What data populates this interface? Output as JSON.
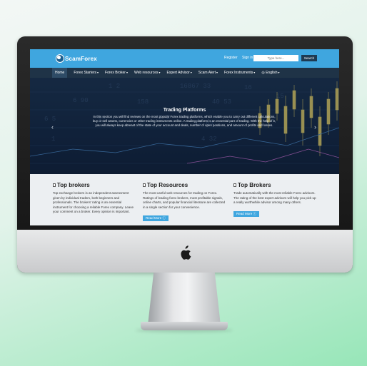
{
  "site": {
    "logo_text": "ScamForex",
    "header_links": [
      "Register",
      "Sign in"
    ],
    "search_placeholder": "Type here...",
    "search_button": "Search"
  },
  "nav": [
    {
      "label": "Home"
    },
    {
      "label": "Forex Starters"
    },
    {
      "label": "Forex Broker"
    },
    {
      "label": "Web resources"
    },
    {
      "label": "Expert Advisor"
    },
    {
      "label": "Scam Alert"
    },
    {
      "label": "Forex Instruments"
    },
    {
      "label": "English"
    }
  ],
  "hero": {
    "title": "Trading Platforms",
    "text": "In this section you will find reviews on the most popular Forex trading platforms, which enable you to carry out different calculations, buy or sell assets, currencies or other trading instruments online. A trading platform is an essential part of trading. With the help of it, you will always keep abreast of the state of your account and deals, number of open positions, and amount of profits and losses.",
    "prev_arrow": "‹",
    "next_arrow": "›"
  },
  "columns": [
    {
      "title": "Top brokers",
      "text": "Top exchange brokers is an independent assessment given by individual traders, both beginners and professionals. The brokers' rating is an essential instrument for choosing a reliable Forex company. Leave your comment on a broker. Every opinion is important.",
      "button": ""
    },
    {
      "title": "Top Resources",
      "text": "The most useful web resources for trading on Forex. Ratings of leading forex brokers, most profitable signals, online charts, and popular financial literature are collected in a single section for your convenience.",
      "button": "Read More"
    },
    {
      "title": "Top Brokers",
      "text": "Trade automatically with the most reliable Forex advisors. The rating of the best expert advisors will help you pick up a really worthwhile advisor among many others.",
      "button": "Read More"
    }
  ],
  "colors": {
    "header_blue": "#3fa6df",
    "nav_navy": "#1f3347",
    "hero_navy": "#142845",
    "candle_yellow": "#e7d36a"
  },
  "icons": [
    "apple-logo-icon",
    "document-icon",
    "globe-icon"
  ]
}
